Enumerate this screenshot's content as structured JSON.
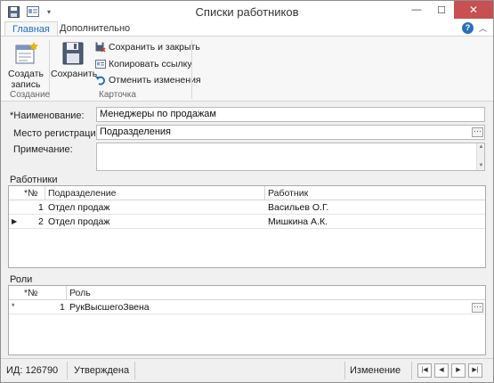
{
  "window": {
    "title": "Списки работников"
  },
  "ribbon": {
    "tabs": [
      {
        "label": "Главная",
        "active": true
      },
      {
        "label": "Дополнительно",
        "active": false
      }
    ],
    "create_label_line1": "Создать",
    "create_label_line2": "запись",
    "save_label": "Сохранить",
    "save_close_label": "Сохранить и закрыть",
    "copy_link_label": "Копировать ссылку",
    "undo_label": "Отменить изменения",
    "group_create": "Создание",
    "group_card": "Карточка"
  },
  "form": {
    "name_label": "*Наименование:",
    "name_value": "Менеджеры по продажам",
    "registration_label": "Место регистрации:",
    "registration_value": "Подразделения",
    "note_label": "Примечание:",
    "note_value": ""
  },
  "workers": {
    "title": "Работники",
    "headers": {
      "num": "*№",
      "department": "Подразделение",
      "worker": "Работник"
    },
    "rows": [
      {
        "num": "1",
        "department": "Отдел продаж",
        "worker": "Васильев О.Г."
      },
      {
        "num": "2",
        "department": "Отдел продаж",
        "worker": "Мишкина А.К."
      }
    ]
  },
  "roles": {
    "title": "Роли",
    "headers": {
      "num": "*№",
      "role": "Роль"
    },
    "rows": [
      {
        "num": "1",
        "role": "РукВысшегоЗвена"
      }
    ]
  },
  "status": {
    "id": "ИД: 126790",
    "state": "Утверждена",
    "mode": "Изменение"
  },
  "colors": {
    "accent": "#1e6fbf",
    "close_button": "#c75050"
  }
}
